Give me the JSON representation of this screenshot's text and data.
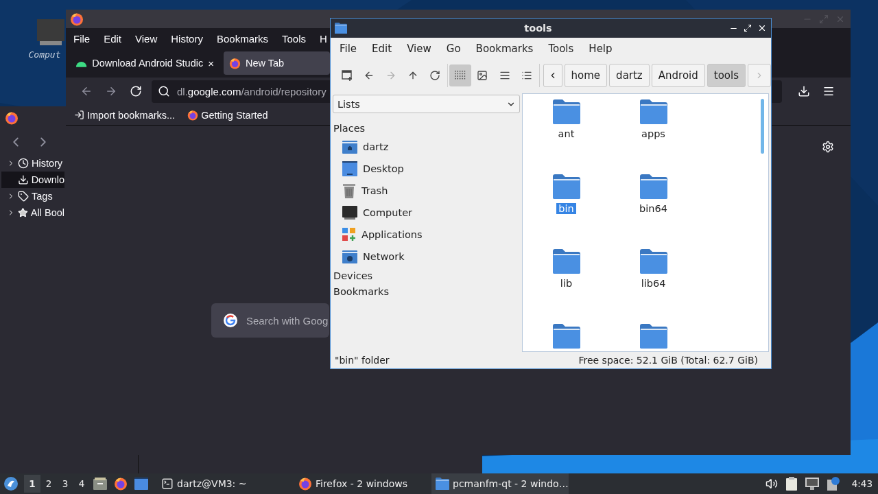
{
  "desktop": {
    "icons": [
      {
        "label": "Comput"
      }
    ]
  },
  "library": {
    "items": [
      {
        "label": "History",
        "expandable": true,
        "selected": false
      },
      {
        "label": "Downlo",
        "expandable": false,
        "selected": true
      },
      {
        "label": "Tags",
        "expandable": true,
        "selected": false
      },
      {
        "label": "All Bool",
        "expandable": true,
        "selected": false
      }
    ]
  },
  "firefox": {
    "menu": [
      "File",
      "Edit",
      "View",
      "History",
      "Bookmarks",
      "Tools",
      "H"
    ],
    "tabs": [
      {
        "label": "Download Android Studic",
        "close": "×",
        "selected": false
      },
      {
        "label": "New Tab",
        "selected": true
      }
    ],
    "url": {
      "host_prefix": "dl.",
      "domain": "google.com",
      "path": "/android/repository"
    },
    "bookmarks": [
      "Import bookmarks...",
      "Getting Started"
    ],
    "search": {
      "placeholder": "Search with Goog"
    }
  },
  "file_manager": {
    "title": "tools",
    "menu": [
      "File",
      "Edit",
      "View",
      "Go",
      "Bookmarks",
      "Tools",
      "Help"
    ],
    "view_modes": [
      {
        "selected": true
      },
      {
        "selected": false
      },
      {
        "selected": false
      },
      {
        "selected": false
      }
    ],
    "path": [
      {
        "label": "home",
        "selected": false
      },
      {
        "label": "dartz",
        "selected": false
      },
      {
        "label": "Android",
        "selected": false
      },
      {
        "label": "tools",
        "selected": true
      }
    ],
    "sidebar": {
      "mode": "Lists",
      "sections": [
        {
          "title": "Places",
          "items": [
            "dartz",
            "Desktop",
            "Trash",
            "Computer",
            "Applications",
            "Network"
          ]
        },
        {
          "title": "Devices"
        },
        {
          "title": "Bookmarks"
        }
      ]
    },
    "files": [
      {
        "name": "ant",
        "selected": false
      },
      {
        "name": "apps",
        "selected": false
      },
      {
        "name": "bin",
        "selected": true
      },
      {
        "name": "bin64",
        "selected": false
      },
      {
        "name": "lib",
        "selected": false
      },
      {
        "name": "lib64",
        "selected": false
      },
      {
        "selected": false
      },
      {
        "selected": false
      }
    ],
    "status": "\"bin\" folder",
    "free_space": "Free space: 52.1 GiB (Total: 62.7 GiB)"
  },
  "taskbar": {
    "desktops": [
      {
        "label": "1",
        "selected": true
      },
      {
        "label": "2",
        "selected": false
      },
      {
        "label": "3",
        "selected": false
      },
      {
        "label": "4",
        "selected": false
      }
    ],
    "tasks": [
      {
        "label": "dartz@VM3: ~",
        "selected": false
      },
      {
        "label": "Firefox - 2 windows",
        "selected": false
      },
      {
        "label": "pcmanfm-qt - 2 windo…",
        "selected": true
      }
    ],
    "clock": "4:43"
  }
}
